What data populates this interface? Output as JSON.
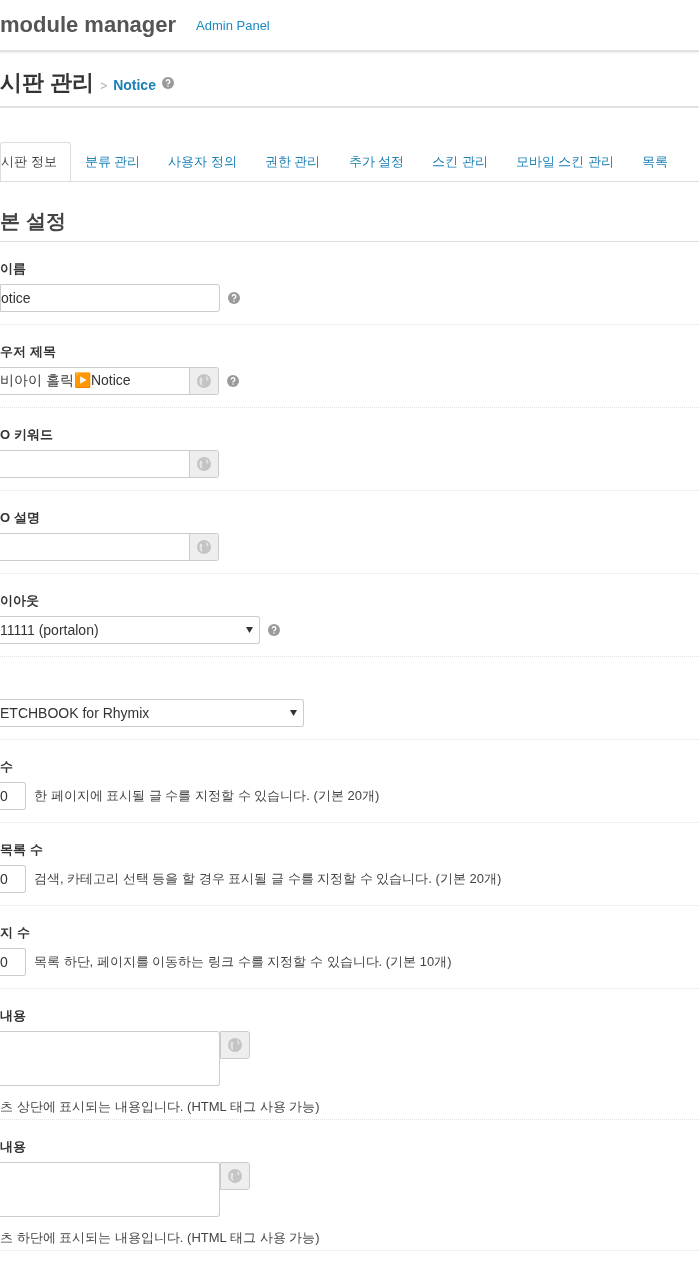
{
  "header": {
    "title": "module manager",
    "link": "Admin Panel"
  },
  "page_title": {
    "title": "시판 관리",
    "separator": ">",
    "module": "Notice"
  },
  "tabs": [
    {
      "label": "시판 정보",
      "selected": true
    },
    {
      "label": "분류 관리",
      "selected": false
    },
    {
      "label": "사용자 정의",
      "selected": false
    },
    {
      "label": "권한 관리",
      "selected": false
    },
    {
      "label": "추가 설정",
      "selected": false
    },
    {
      "label": "스킨 관리",
      "selected": false
    },
    {
      "label": "모바일 스킨 관리",
      "selected": false
    },
    {
      "label": "목록",
      "selected": false
    }
  ],
  "section": "본 설정",
  "fields": [
    {
      "kind": "text",
      "label": "이름",
      "value": "otice",
      "help": true
    },
    {
      "kind": "lang",
      "label": "우저 제목",
      "value": "비아이 홀릭▶️Notice",
      "help": true
    },
    {
      "kind": "lang",
      "label": "O 키워드",
      "help": false
    },
    {
      "kind": "lang",
      "label": "O 설명",
      "help": false
    },
    {
      "kind": "select",
      "label": "이아웃",
      "value": "11111 (portalon)",
      "help": true
    },
    {
      "kind": "select-wide",
      "value": "ETCHBOOK for Rhymix",
      "help": false
    },
    {
      "kind": "number",
      "label": "수",
      "value": "0",
      "description": "한 페이지에 표시될 글 수를 지정할 수 있습니다. (기본 20개)"
    },
    {
      "kind": "number",
      "label": "목록 수",
      "value": "0",
      "description": "검색, 카테고리 선택 등을 할 경우 표시될 글 수를 지정할 수 있습니다. (기본 20개)"
    },
    {
      "kind": "number",
      "label": "지 수",
      "value": "0",
      "description": "목록 하단, 페이지를 이동하는 링크 수를 지정할 수 있습니다. (기본 10개)"
    },
    {
      "kind": "textarea",
      "label": "내용",
      "description": "츠 상단에 표시되는 내용입니다. (HTML 태그 사용 가능)"
    },
    {
      "kind": "textarea",
      "label": "내용",
      "description": "츠 하단에 표시되는 내용입니다. (HTML 태그 사용 가능)"
    }
  ]
}
